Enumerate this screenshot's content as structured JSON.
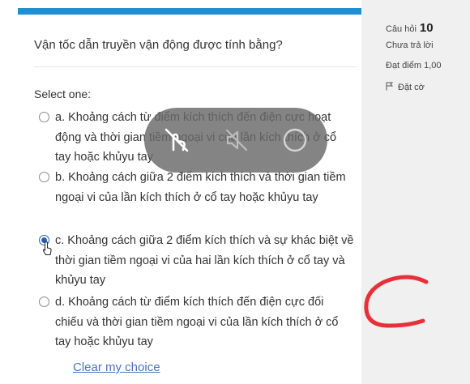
{
  "question": {
    "text": "Vận tốc dẫn truyền vận động được tính bằng?",
    "prompt": "Select one:",
    "options": [
      {
        "text": "a. Khoảng cách từ điểm kích thích đến điện cực hoạt động và thời gian tiềm ngoại vi của lần kích thích ở cổ tay hoặc khủyu tay",
        "selected": false
      },
      {
        "text": "b. Khoảng cách giữa 2 điểm kích thích và thời gian tiềm ngoại vi của lần kích thích ở cổ tay hoặc khủyu tay",
        "selected": false
      },
      {
        "text": "c. Khoảng cách giữa 2 điểm kích thích và sự khác biệt về thời gian tiềm ngoại vi của hai lần kích thích ở cổ tay và khủyu tay",
        "selected": true
      },
      {
        "text": "d. Khoảng cách từ điểm kích thích đến điện cực đối chiếu và thời gian tiềm ngoại vi của lần kích thích ở cổ tay hoặc khủyu tay",
        "selected": false
      }
    ],
    "clear_label": "Clear my choice"
  },
  "sidebar": {
    "question_label": "Câu hỏi",
    "question_number": "10",
    "status": "Chưa trả lời",
    "points": "Đạt điểm 1,00",
    "flag_label": "Đặt cờ"
  },
  "colors": {
    "accent_bar": "#1f8fd2",
    "link": "#4a73c3",
    "radio_selected": "#2b5fb3",
    "annotation": "#e8303a",
    "sidebar_bg": "#f0f0f0"
  },
  "overlay_icons": [
    "no-touch-icon",
    "mute-icon",
    "circle-icon"
  ]
}
